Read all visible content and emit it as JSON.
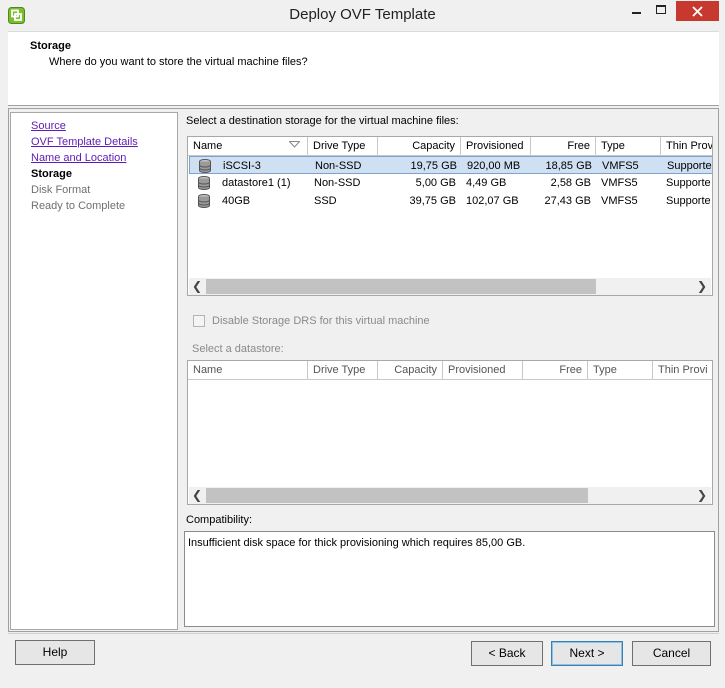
{
  "window": {
    "title": "Deploy OVF Template"
  },
  "header": {
    "title": "Storage",
    "subtitle": "Where do you want to store the virtual machine files?"
  },
  "steps": [
    {
      "label": "Source",
      "state": "link"
    },
    {
      "label": "OVF Template Details",
      "state": "link"
    },
    {
      "label": "Name and Location",
      "state": "link"
    },
    {
      "label": "Storage",
      "state": "current"
    },
    {
      "label": "Disk Format",
      "state": "disabled"
    },
    {
      "label": "Ready to Complete",
      "state": "disabled"
    }
  ],
  "destination": {
    "label": "Select a destination storage for the virtual machine files:",
    "columns": [
      "Name",
      "Drive Type",
      "Capacity",
      "Provisioned",
      "Free",
      "Type",
      "Thin Prov"
    ],
    "rows": [
      {
        "name": "iSCSI-3",
        "drive_type": "Non-SSD",
        "capacity": "19,75 GB",
        "provisioned": "920,00 MB",
        "free": "18,85 GB",
        "type": "VMFS5",
        "thin": "Supporte",
        "selected": true
      },
      {
        "name": "datastore1 (1)",
        "drive_type": "Non-SSD",
        "capacity": "5,00 GB",
        "provisioned": "4,49 GB",
        "free": "2,58 GB",
        "type": "VMFS5",
        "thin": "Supporte",
        "selected": false
      },
      {
        "name": "40GB",
        "drive_type": "SSD",
        "capacity": "39,75 GB",
        "provisioned": "102,07 GB",
        "free": "27,43 GB",
        "type": "VMFS5",
        "thin": "Supporte",
        "selected": false
      }
    ]
  },
  "drs": {
    "label": "Disable Storage DRS for this virtual machine",
    "checked": false,
    "enabled": false
  },
  "datastore": {
    "label": "Select a datastore:",
    "columns": [
      "Name",
      "Drive Type",
      "Capacity",
      "Provisioned",
      "Free",
      "Type",
      "Thin Provi"
    ]
  },
  "compatibility": {
    "label": "Compatibility:",
    "message": "Insufficient disk space for thick provisioning which requires 85,00 GB."
  },
  "buttons": {
    "help": "Help",
    "back": "< Back",
    "next": "Next >",
    "cancel": "Cancel"
  },
  "colors": {
    "selection": "#cfe0f3",
    "link": "#5f1cb3",
    "close_button": "#c7392e"
  },
  "icons": {
    "app": "vsphere-icon",
    "datastore": "database-icon",
    "sort": "sort-icon"
  }
}
